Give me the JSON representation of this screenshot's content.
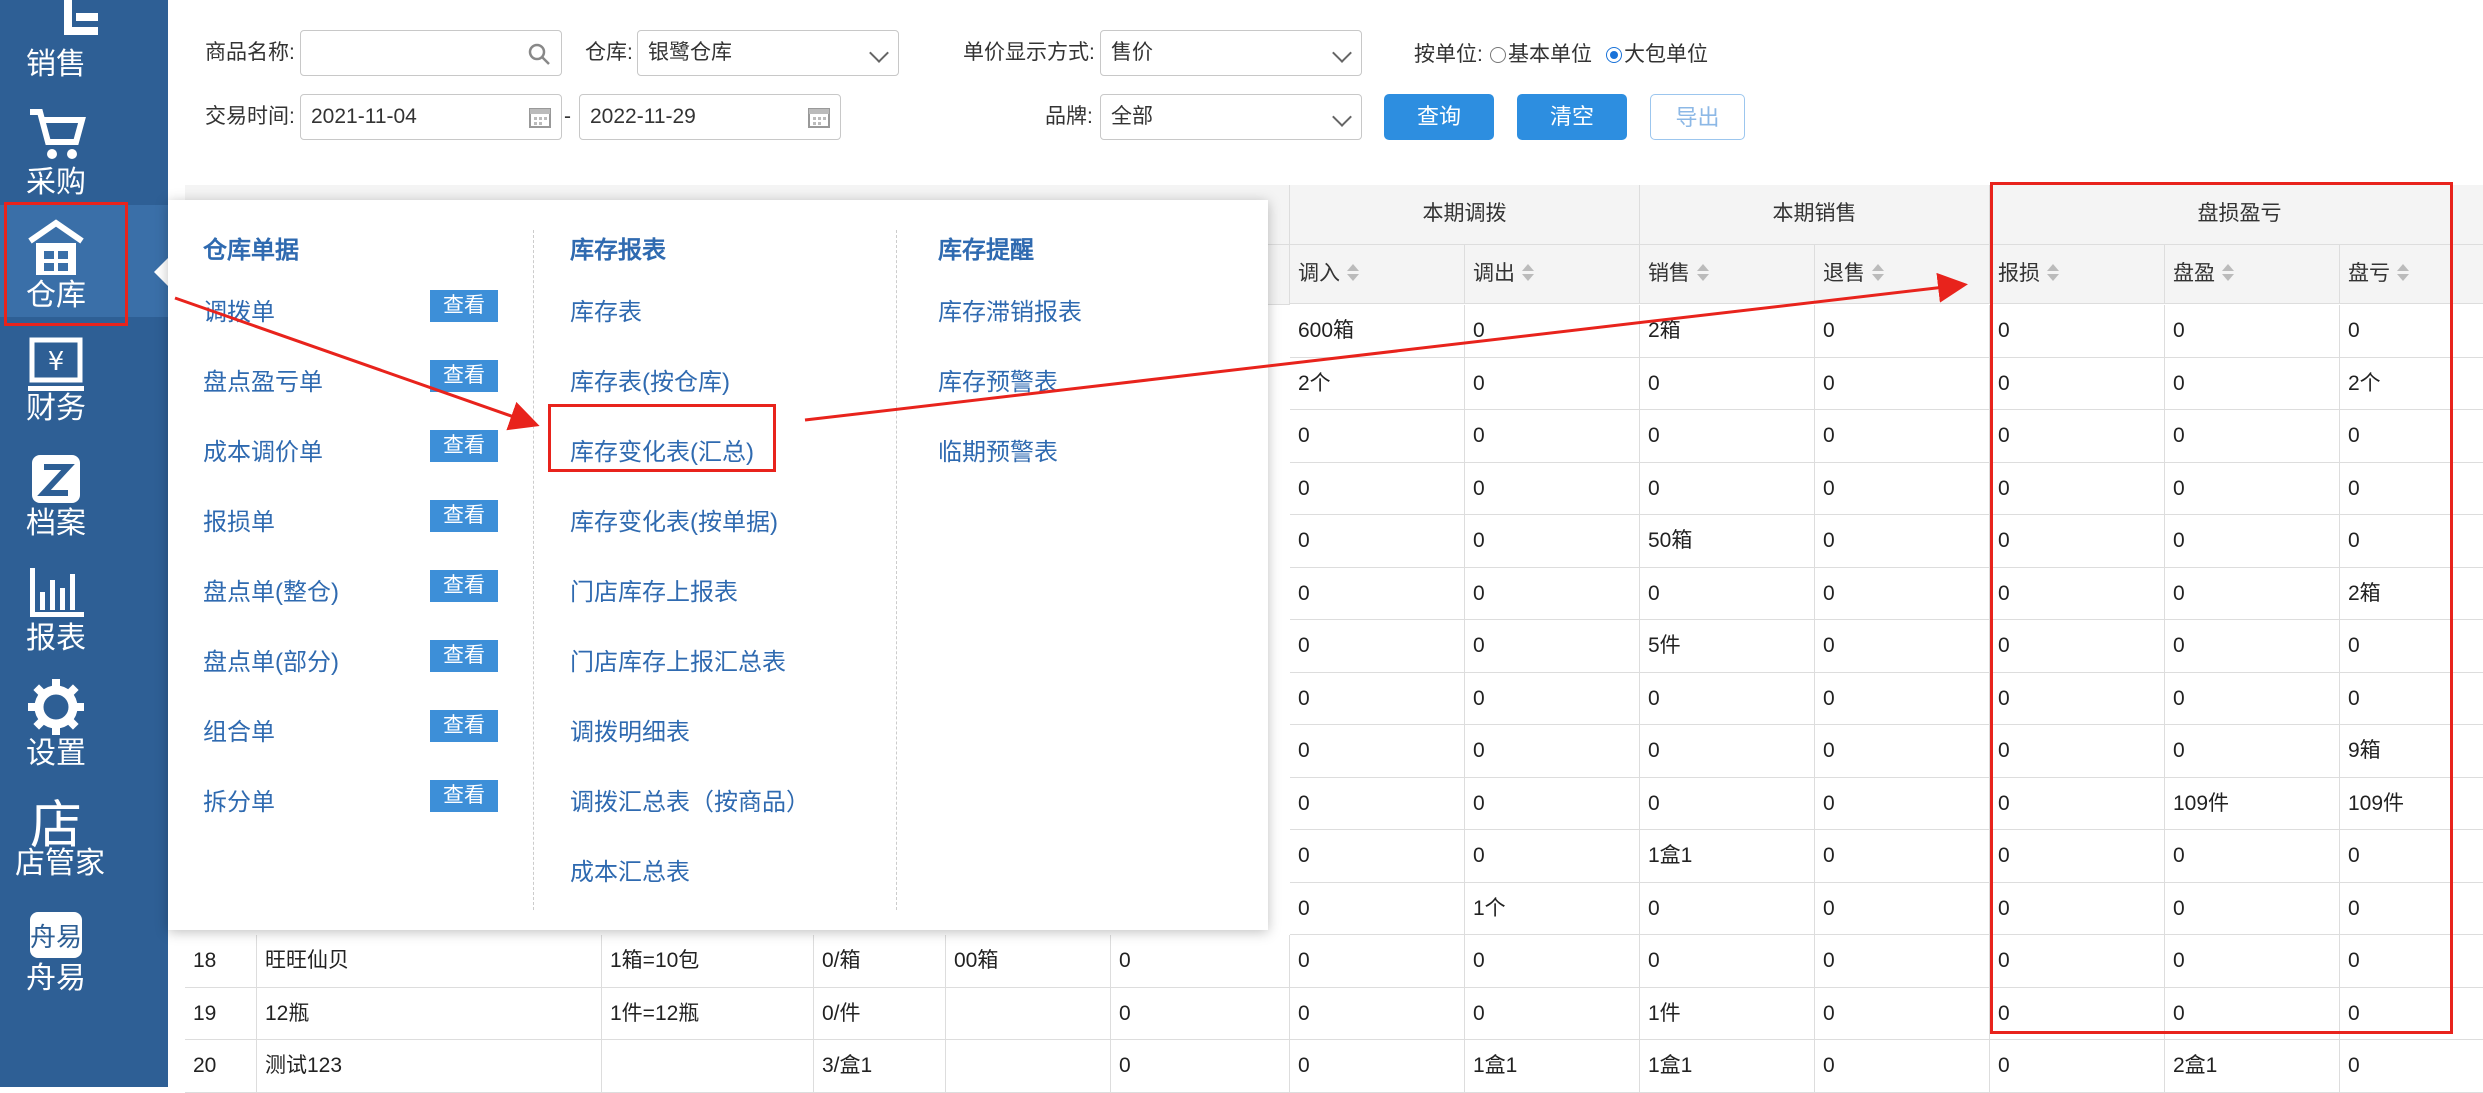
{
  "sidebar": {
    "items": [
      {
        "label": "销售",
        "icon": "sales-icon"
      },
      {
        "label": "采购",
        "icon": "cart-icon"
      },
      {
        "label": "仓库",
        "icon": "warehouse-icon"
      },
      {
        "label": "财务",
        "icon": "finance-icon"
      },
      {
        "label": "档案",
        "icon": "archive-icon"
      },
      {
        "label": "报表",
        "icon": "report-icon"
      },
      {
        "label": "设置",
        "icon": "gear-icon"
      },
      {
        "label": "店管家",
        "icon": "store-icon"
      },
      {
        "label": "舟易",
        "icon": "zhouyi-icon"
      }
    ]
  },
  "filters": {
    "product_name_label": "商品名称:",
    "product_name_value": "",
    "warehouse_label": "仓库:",
    "warehouse_value": "银鹭仓库",
    "price_mode_label": "单价显示方式:",
    "price_mode_value": "售价",
    "unit_label": "按单位:",
    "unit_base": "基本单位",
    "unit_pack": "大包单位",
    "unit_selected": "大包单位",
    "date_label": "交易时间:",
    "date_from": "2021-11-04",
    "date_sep": "-",
    "date_to": "2022-11-29",
    "brand_label": "品牌:",
    "brand_value": "全部",
    "query_btn": "查询",
    "clear_btn": "清空",
    "export_btn": "导出"
  },
  "table": {
    "groups": [
      "本期调拨",
      "本期销售",
      "盘损盈亏"
    ],
    "columns": [
      "调入",
      "调出",
      "销售",
      "退售",
      "报损",
      "盘盈",
      "盘亏"
    ],
    "rows": [
      {
        "cells": [
          "600箱",
          "0",
          "2箱",
          "0",
          "0",
          "0",
          "0"
        ]
      },
      {
        "cells": [
          "2个",
          "0",
          "0",
          "0",
          "0",
          "0",
          "2个"
        ]
      },
      {
        "cells": [
          "0",
          "0",
          "0",
          "0",
          "0",
          "0",
          "0"
        ]
      },
      {
        "cells": [
          "0",
          "0",
          "0",
          "0",
          "0",
          "0",
          "0"
        ]
      },
      {
        "cells": [
          "0",
          "0",
          "50箱",
          "0",
          "0",
          "0",
          "0"
        ]
      },
      {
        "cells": [
          "0",
          "0",
          "0",
          "0",
          "0",
          "0",
          "2箱"
        ]
      },
      {
        "cells": [
          "0",
          "0",
          "5件",
          "0",
          "0",
          "0",
          "0"
        ]
      },
      {
        "cells": [
          "0",
          "0",
          "0",
          "0",
          "0",
          "0",
          "0"
        ]
      },
      {
        "cells": [
          "0",
          "0",
          "0",
          "0",
          "0",
          "0",
          "9箱"
        ]
      },
      {
        "cells": [
          "0",
          "0",
          "0",
          "0",
          "0",
          "109件",
          "109件"
        ]
      },
      {
        "cells": [
          "0",
          "0",
          "1盒1",
          "0",
          "0",
          "0",
          "0"
        ]
      },
      {
        "cells": [
          "0",
          "1个",
          "0",
          "0",
          "0",
          "0",
          "0"
        ]
      },
      {
        "num": "18",
        "name": "旺旺仙贝",
        "spec": "1箱=10包",
        "c4": "0/箱",
        "c5": "00箱",
        "c6": "0",
        "cells": [
          "0",
          "0",
          "0",
          "0",
          "0",
          "0",
          "0"
        ]
      },
      {
        "num": "19",
        "name": "12瓶",
        "spec": "1件=12瓶",
        "c4": "0/件",
        "c5": "",
        "c6": "0",
        "cells": [
          "0",
          "0",
          "1件",
          "0",
          "0",
          "0",
          "0"
        ]
      },
      {
        "num": "20",
        "name": "测试123",
        "spec": "",
        "c4": "3/盒1",
        "c5": "",
        "c6": "0",
        "cells": [
          "0",
          "1盒1",
          "1盒1",
          "0",
          "0",
          "2盒1",
          "0"
        ]
      }
    ]
  },
  "popup": {
    "col1": {
      "title": "仓库单据",
      "view_label": "查看",
      "items": [
        "调拨单",
        "盘点盈亏单",
        "成本调价单",
        "报损单",
        "盘点单(整仓)",
        "盘点单(部分)",
        "组合单",
        "拆分单"
      ]
    },
    "col2": {
      "title": "库存报表",
      "items": [
        "库存表",
        "库存表(按仓库)",
        "库存变化表(汇总)",
        "库存变化表(按单据)",
        "门店库存上报表",
        "门店库存上报汇总表",
        "调拨明细表",
        "调拨汇总表（按商品）",
        "成本汇总表"
      ]
    },
    "col3": {
      "title": "库存提醒",
      "items": [
        "库存滞销报表",
        "库存预警表",
        "临期预警表"
      ]
    }
  },
  "colors": {
    "sidebar": "#2e5f95",
    "accent": "#2d8ee0",
    "link": "#2f6ab0",
    "annotation": "#e8231c"
  }
}
